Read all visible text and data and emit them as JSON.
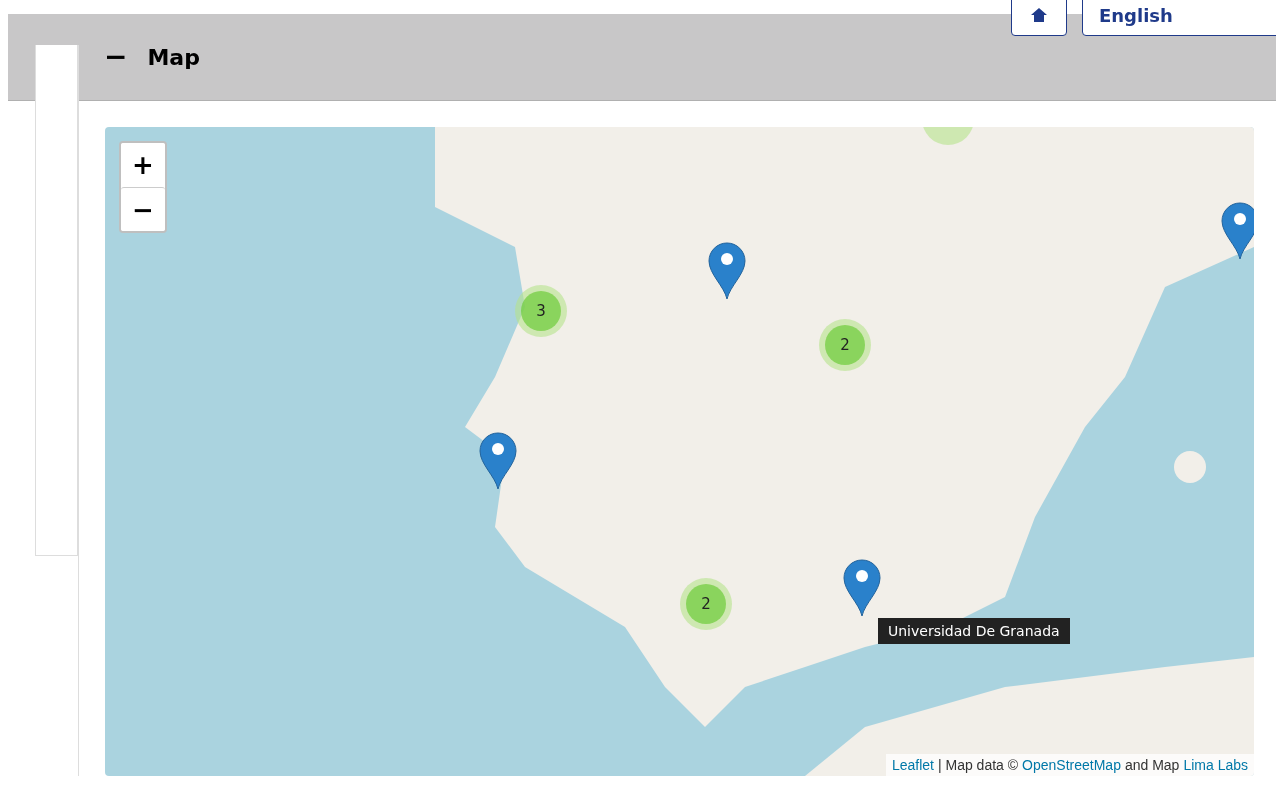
{
  "top_bar": {
    "language": "English"
  },
  "panel": {
    "title": "Map",
    "expanded": true,
    "toggle": "−"
  },
  "map": {
    "zoom_in": "+",
    "zoom_out": "−",
    "markers": [
      {
        "kind": "cluster",
        "count": "3"
      },
      {
        "kind": "cluster",
        "count": "2"
      },
      {
        "kind": "cluster",
        "count": "2"
      },
      {
        "kind": "cluster"
      },
      {
        "kind": "pin"
      },
      {
        "kind": "pin"
      },
      {
        "kind": "pin"
      },
      {
        "kind": "pin"
      }
    ],
    "tooltip": "Universidad De Granada",
    "attribution": {
      "leaflet": "Leaflet",
      "separator": "| Map data ©",
      "osm": "OpenStreetMap",
      "and": "and Map",
      "lima": "Lima Labs"
    }
  }
}
